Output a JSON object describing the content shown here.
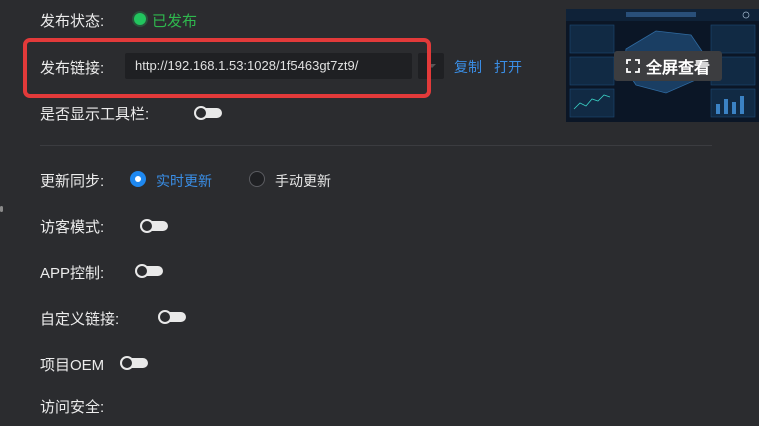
{
  "publish": {
    "status_label": "发布状态:",
    "status_value": "已发布",
    "link_label": "发布链接:",
    "link_url": "http://192.168.1.53:1028/1f5463gt7zt9/",
    "copy_label": "复制",
    "open_label": "打开",
    "toolbar_label": "是否显示工具栏:"
  },
  "preview": {
    "fullscreen_label": "全屏查看"
  },
  "sync": {
    "label": "更新同步:",
    "options": [
      {
        "label": "实时更新",
        "selected": true
      },
      {
        "label": "手动更新",
        "selected": false
      }
    ]
  },
  "settings": {
    "visitor_mode_label": "访客模式:",
    "app_control_label": "APP控制:",
    "custom_link_label": "自定义链接:",
    "oem_label": "项目OEM",
    "access_security_label": "访问安全:"
  },
  "colors": {
    "accent": "#3a8ee6",
    "published_green": "#22c55e",
    "highlight_red": "#e23a3a",
    "background": "#2b2c2f"
  }
}
